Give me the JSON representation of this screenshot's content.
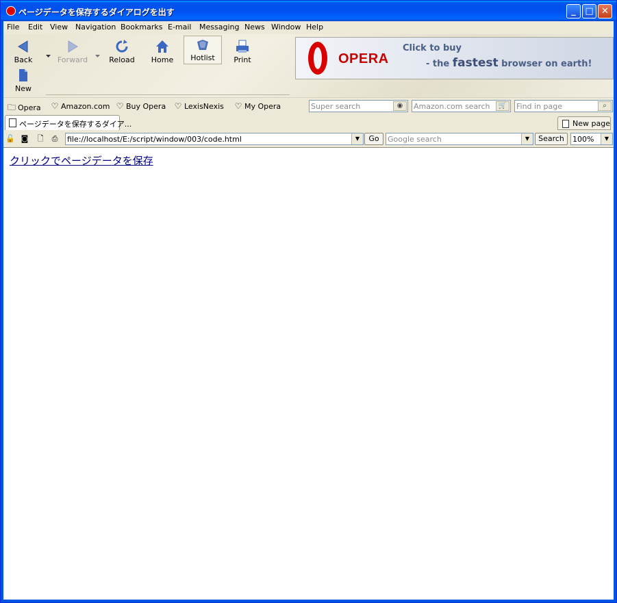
{
  "window": {
    "title": "ページデータを保存するダイアログを出す",
    "controls": {
      "minimize": "_",
      "maximize": "□",
      "close": "✕"
    }
  },
  "menu": [
    "File",
    "Edit",
    "View",
    "Navigation",
    "Bookmarks",
    "E-mail",
    "Messaging",
    "News",
    "Window",
    "Help"
  ],
  "toolbar": {
    "back": "Back",
    "forward": "Forward",
    "reload": "Reload",
    "home": "Home",
    "hotlist": "Hotlist",
    "print": "Print",
    "new": "New"
  },
  "banner": {
    "brand": "OPERA",
    "line1": "Click to buy",
    "line2_prefix": "- the ",
    "line2_emph": "fastest",
    "line2_suffix": " browser on earth!"
  },
  "personal_bar": {
    "items": [
      "Opera",
      "Amazon.com",
      "Buy Opera",
      "LexisNexis",
      "My Opera"
    ],
    "super_search_placeholder": "Super search",
    "amazon_search_placeholder": "Amazon.com search",
    "find_placeholder": "Find in page"
  },
  "tabs": {
    "active_label": "ページデータを保存するダイア...",
    "new_page": "New page"
  },
  "address_bar": {
    "url": "file://localhost/E:/script/window/003/code.html",
    "go": "Go",
    "google_placeholder": "Google search",
    "search": "Search",
    "zoom": "100%"
  },
  "page": {
    "link_text": "クリックでページデータを保存"
  },
  "colors": {
    "titlebar": "#0054e3",
    "chrome": "#ece9d8",
    "link": "#000080",
    "opera_red": "#c80000"
  }
}
